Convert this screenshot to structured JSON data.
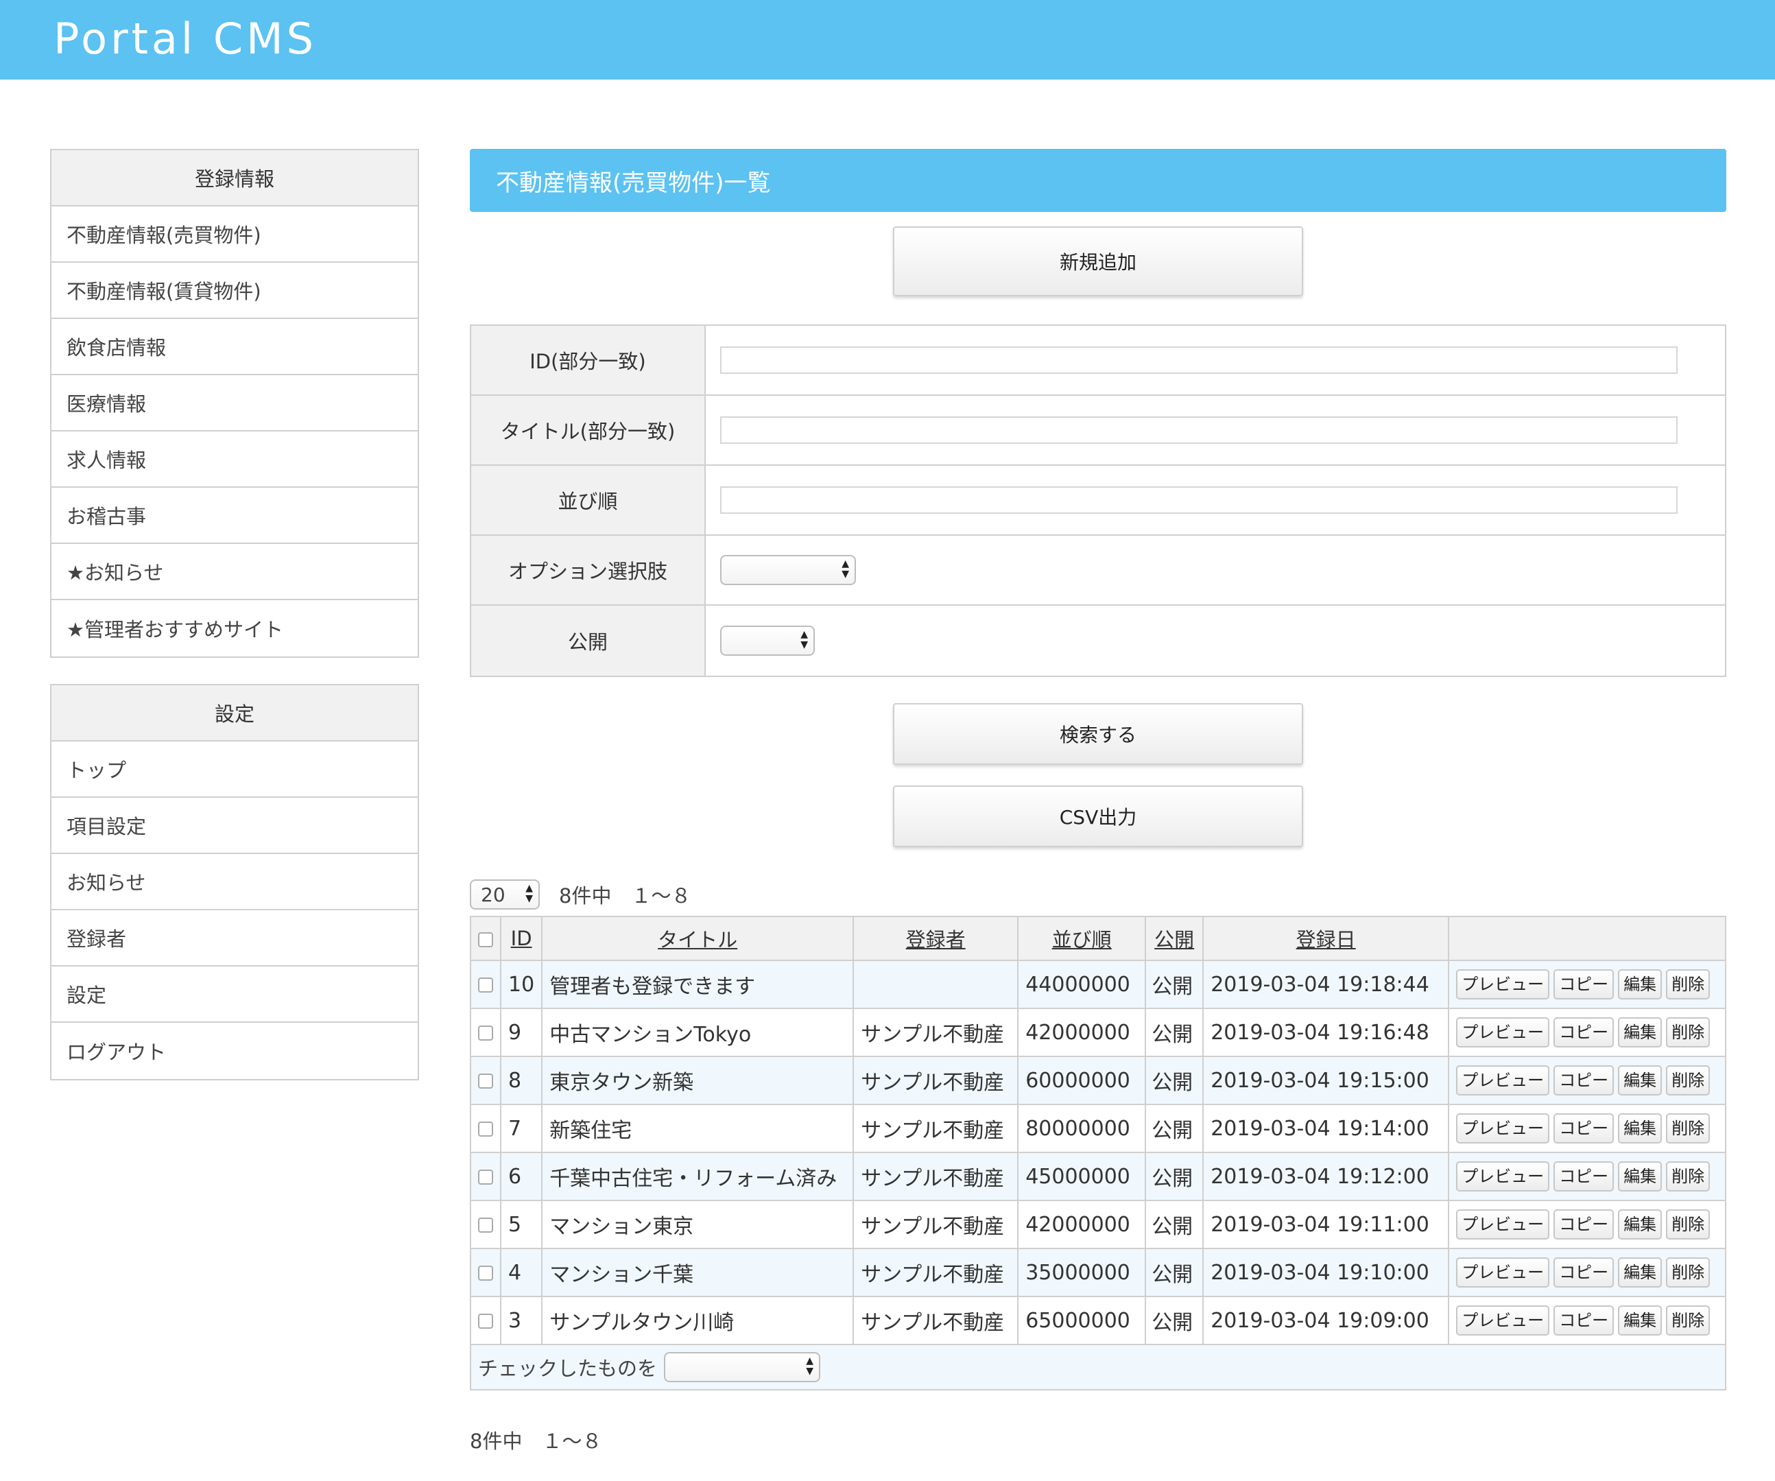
{
  "app": {
    "brand": "Portal CMS"
  },
  "sidebar": {
    "registration": {
      "heading": "登録情報",
      "items": [
        {
          "label": "不動産情報(売買物件)"
        },
        {
          "label": "不動産情報(賃貸物件)"
        },
        {
          "label": "飲食店情報"
        },
        {
          "label": "医療情報"
        },
        {
          "label": "求人情報"
        },
        {
          "label": "お稽古事"
        },
        {
          "label": "★お知らせ"
        },
        {
          "label": "★管理者おすすめサイト"
        }
      ]
    },
    "settings": {
      "heading": "設定",
      "items": [
        {
          "label": "トップ"
        },
        {
          "label": "項目設定"
        },
        {
          "label": "お知らせ"
        },
        {
          "label": "登録者"
        },
        {
          "label": "設定"
        },
        {
          "label": "ログアウト"
        }
      ]
    }
  },
  "main": {
    "title": "不動産情報(売買物件)一覧",
    "add_button": "新規追加",
    "search": {
      "id_label": "ID(部分一致)",
      "id_value": "",
      "title_label": "タイトル(部分一致)",
      "title_value": "",
      "order_label": "並び順",
      "order_value": "",
      "option_label": "オプション選択肢",
      "option_value": "",
      "public_label": "公開",
      "public_value": ""
    },
    "search_button": "検索する",
    "csv_button": "CSV出力",
    "per_page": "20",
    "count_text": "8件中　１～８",
    "table": {
      "headers": [
        "ID",
        "タイトル",
        "登録者",
        "並び順",
        "公開",
        "登録日"
      ],
      "action_labels": {
        "preview": "プレビュー",
        "copy": "コピー",
        "edit": "編集",
        "delete": "削除"
      },
      "rows": [
        {
          "id": "10",
          "title": "管理者も登録できます",
          "registrant": "",
          "order": "44000000",
          "public": "公開",
          "date": "2019-03-04 19:18:44"
        },
        {
          "id": "9",
          "title": "中古マンションTokyo",
          "registrant": "サンプル不動産",
          "order": "42000000",
          "public": "公開",
          "date": "2019-03-04 19:16:48"
        },
        {
          "id": "8",
          "title": "東京タウン新築",
          "registrant": "サンプル不動産",
          "order": "60000000",
          "public": "公開",
          "date": "2019-03-04 19:15:00"
        },
        {
          "id": "7",
          "title": "新築住宅",
          "registrant": "サンプル不動産",
          "order": "80000000",
          "public": "公開",
          "date": "2019-03-04 19:14:00"
        },
        {
          "id": "6",
          "title": "千葉中古住宅・リフォーム済み",
          "registrant": "サンプル不動産",
          "order": "45000000",
          "public": "公開",
          "date": "2019-03-04 19:12:00"
        },
        {
          "id": "5",
          "title": "マンション東京",
          "registrant": "サンプル不動産",
          "order": "42000000",
          "public": "公開",
          "date": "2019-03-04 19:11:00"
        },
        {
          "id": "4",
          "title": "マンション千葉",
          "registrant": "サンプル不動産",
          "order": "35000000",
          "public": "公開",
          "date": "2019-03-04 19:10:00"
        },
        {
          "id": "3",
          "title": "サンプルタウン川崎",
          "registrant": "サンプル不動産",
          "order": "65000000",
          "public": "公開",
          "date": "2019-03-04 19:09:00"
        }
      ]
    },
    "bulk_label": "チェックしたものを",
    "bulk_value": "",
    "footer_count": "8件中　１～８"
  }
}
